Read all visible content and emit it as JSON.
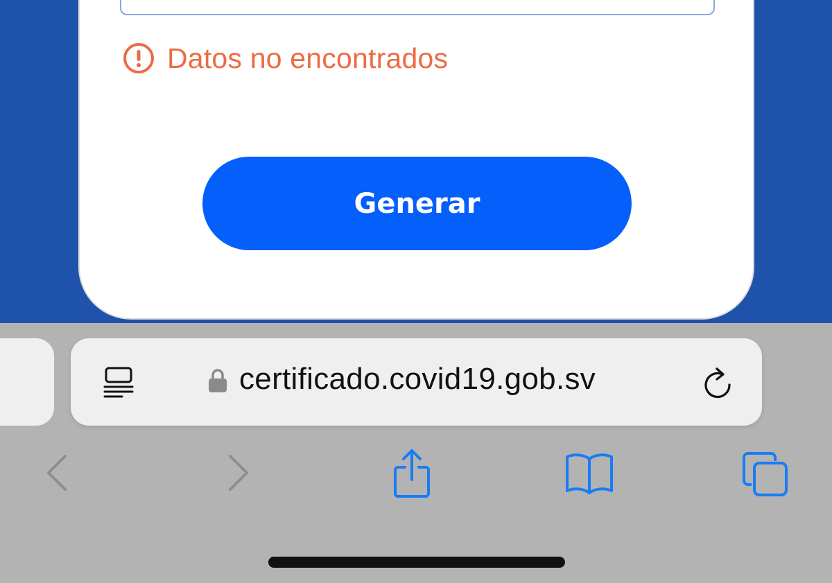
{
  "error": {
    "message": "Datos no encontrados",
    "icon": "alert-circle-icon",
    "color": "#ee6a43"
  },
  "form": {
    "generate_label": "Generar"
  },
  "browser": {
    "url": "certificado.covid19.gob.sv",
    "icons": {
      "reader": "reader-mode-icon",
      "lock": "lock-icon",
      "reload": "reload-icon",
      "back": "back-icon",
      "forward": "forward-icon",
      "share": "share-icon",
      "bookmarks": "bookmarks-icon",
      "tabs": "tabs-icon"
    }
  },
  "colors": {
    "page_background": "#1f52ab",
    "button": "#0560fb",
    "toolbar": "#b3b3b3",
    "system_blue": "#1a7cf5"
  }
}
